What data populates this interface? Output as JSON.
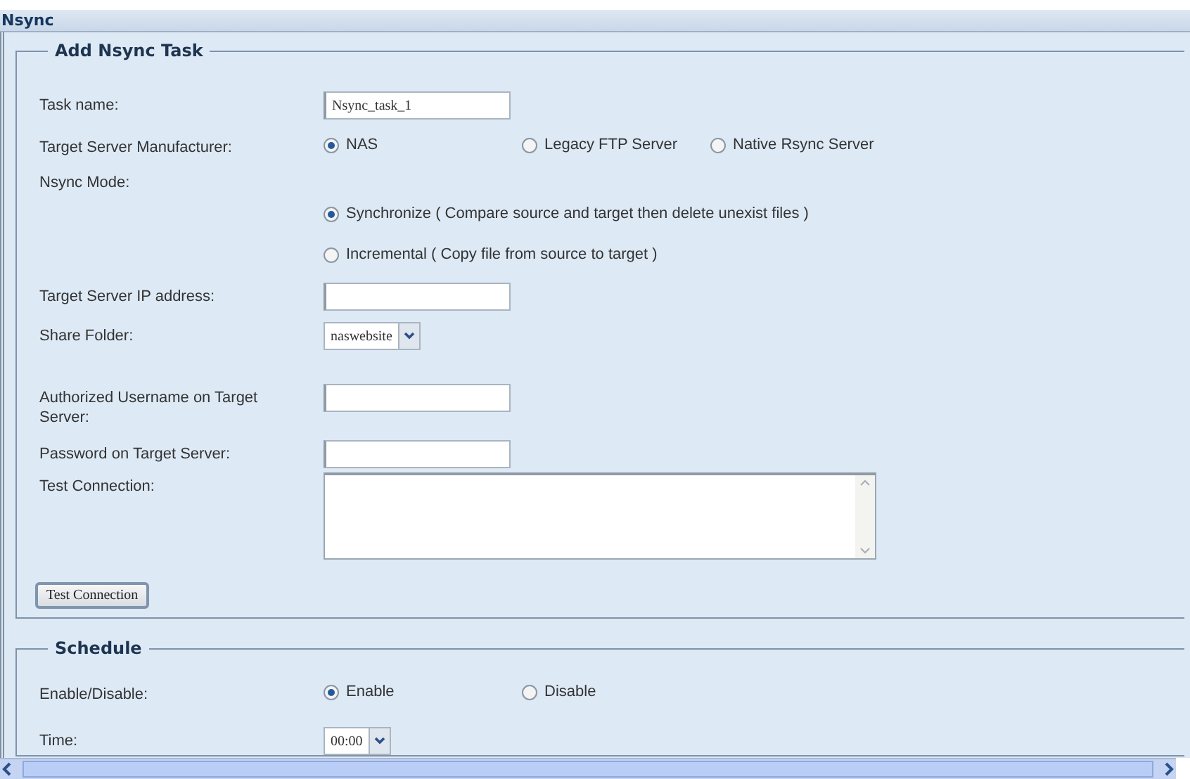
{
  "panel": {
    "title": "Nsync"
  },
  "add_task": {
    "legend": "Add Nsync Task",
    "rows": [
      {
        "kind": "text",
        "label": "Task name:",
        "value": "Nsync_task_1"
      },
      {
        "kind": "radio",
        "label": "Target Server Manufacturer:",
        "options": [
          {
            "label": "NAS",
            "selected": true
          },
          {
            "label": "Legacy FTP Server",
            "selected": false
          },
          {
            "label": "Native Rsync Server",
            "selected": false
          }
        ]
      },
      {
        "kind": "radio_stack",
        "label": "Nsync Mode:",
        "options": [
          {
            "label": "Synchronize ( Compare source and target then delete unexist files )",
            "selected": true
          },
          {
            "label": "Incremental ( Copy file from source to target )",
            "selected": false
          }
        ]
      },
      {
        "kind": "text",
        "label": "Target Server IP address:"
      },
      {
        "kind": "select",
        "label": "Share Folder:",
        "value": "naswebsite"
      },
      {
        "kind": "text",
        "label": "Authorized Username on Target Server:"
      },
      {
        "kind": "text",
        "label": "Password on Target Server:"
      },
      {
        "kind": "textarea",
        "label": "Test Connection:"
      }
    ],
    "button": "Test Connection"
  },
  "schedule": {
    "legend": "Schedule",
    "rows": [
      {
        "kind": "radio",
        "label": "Enable/Disable:",
        "options": [
          {
            "label": "Enable",
            "selected": true
          },
          {
            "label": "Disable",
            "selected": false
          }
        ]
      },
      {
        "kind": "select",
        "label": "Time:",
        "value": "00:00"
      }
    ]
  }
}
